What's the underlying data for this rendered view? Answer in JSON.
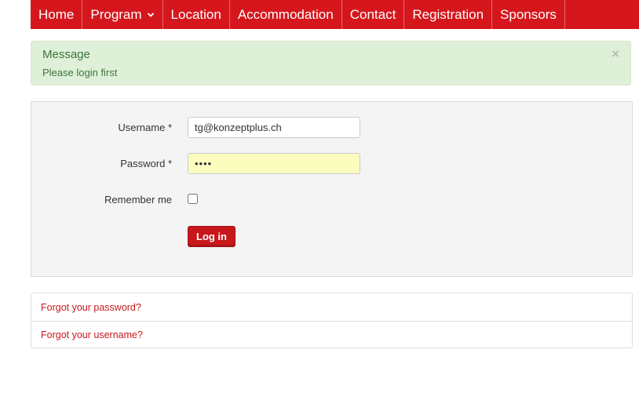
{
  "nav": {
    "items": [
      {
        "label": "Home"
      },
      {
        "label": "Program",
        "has_dropdown": true,
        "icon": "chevron-down-icon"
      },
      {
        "label": "Location"
      },
      {
        "label": "Accommodation"
      },
      {
        "label": "Contact"
      },
      {
        "label": "Registration"
      },
      {
        "label": "Sponsors"
      }
    ]
  },
  "alert": {
    "heading": "Message",
    "text": "Please login first",
    "close": "×"
  },
  "login": {
    "username_label": "Username *",
    "username_value": "tg@konzeptplus.ch",
    "password_label": "Password *",
    "password_value": "••••",
    "remember_label": "Remember me",
    "remember_checked": false,
    "submit_label": "Log in"
  },
  "links": {
    "forgot_password": "Forgot your password?",
    "forgot_username": "Forgot your username?"
  },
  "colors": {
    "brand_red": "#d5171d",
    "alert_bg": "#dff0d8",
    "alert_text": "#3c763d",
    "password_autofill": "#fafdbd"
  }
}
